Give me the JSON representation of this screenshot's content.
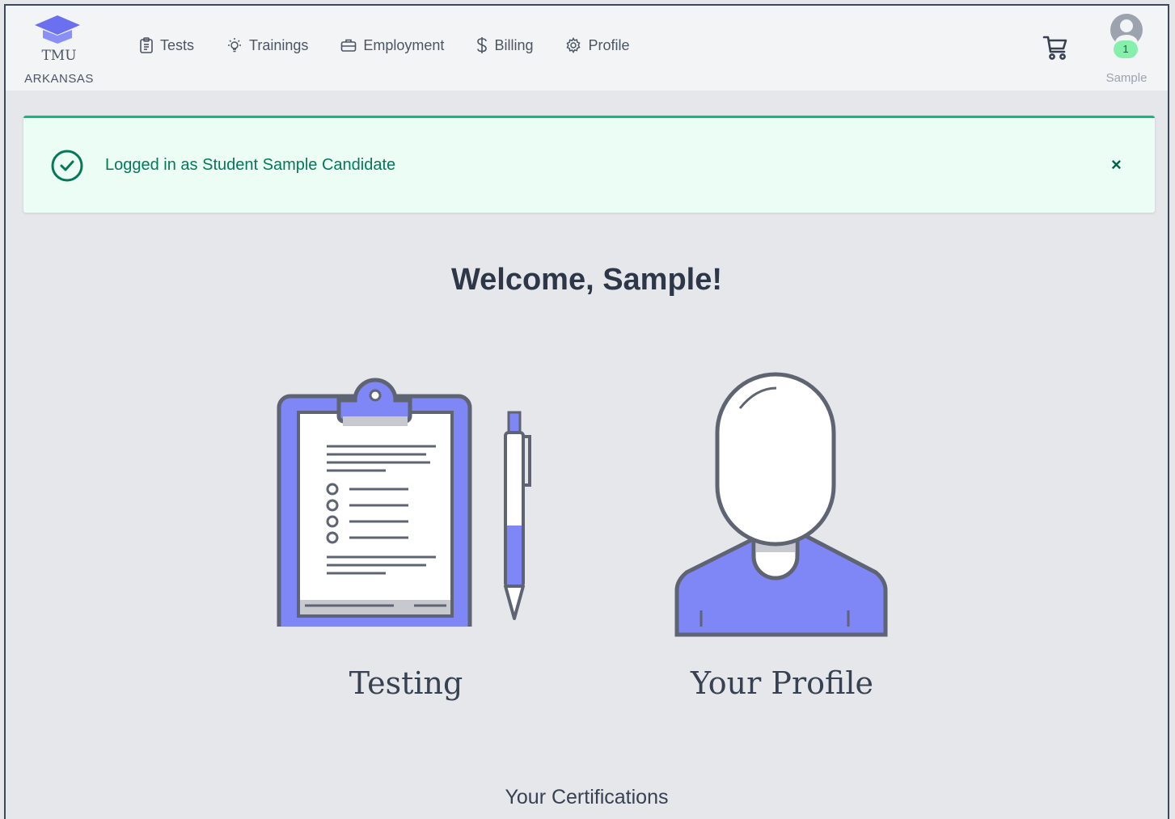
{
  "brand": {
    "name": "TMU",
    "state": "ARKANSAS"
  },
  "nav": {
    "items": [
      {
        "label": "Tests",
        "icon": "clipboard-icon"
      },
      {
        "label": "Trainings",
        "icon": "lightbulb-icon"
      },
      {
        "label": "Employment",
        "icon": "briefcase-icon"
      },
      {
        "label": "Billing",
        "icon": "dollar-icon"
      },
      {
        "label": "Profile",
        "icon": "gear-icon"
      }
    ],
    "cart_icon": "cart-icon",
    "user": {
      "name": "Sample",
      "badge": "1"
    }
  },
  "alert": {
    "message": "Logged in as Student Sample Candidate",
    "close": "×",
    "color": "#10b981"
  },
  "welcome": "Welcome, Sample!",
  "cards": {
    "testing": {
      "label": "Testing",
      "icon": "clipboard-test-illustration"
    },
    "profile": {
      "label": "Your Profile",
      "icon": "person-illustration"
    }
  },
  "certifications_heading": "Your Certifications",
  "colors": {
    "accent": "#7f86f6",
    "outline": "#5f6472",
    "success": "#10b981"
  }
}
